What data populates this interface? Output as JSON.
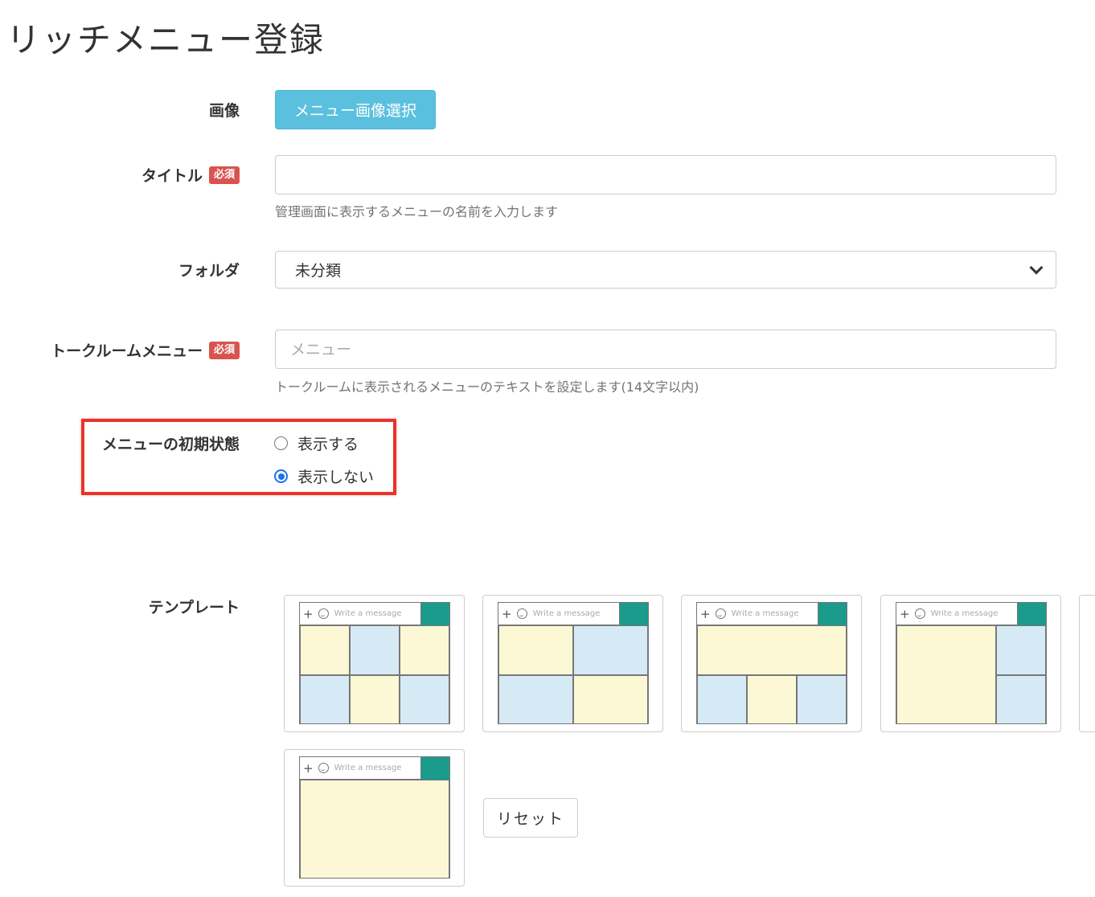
{
  "page_title": "リッチメニュー登録",
  "required_badge": "必須",
  "image": {
    "label": "画像",
    "button_label": "メニュー画像選択"
  },
  "title_field": {
    "label": "タイトル",
    "value": "",
    "help": "管理画面に表示するメニューの名前を入力します"
  },
  "folder": {
    "label": "フォルダ",
    "selected": "未分類"
  },
  "talkroom_menu": {
    "label": "トークルームメニュー",
    "placeholder": "メニュー",
    "help": "トークルームに表示されるメニューのテキストを設定します(14文字以内)"
  },
  "initial_state": {
    "label": "メニューの初期状態",
    "options": [
      {
        "label": "表示する",
        "checked": false
      },
      {
        "label": "表示しない",
        "checked": true
      }
    ]
  },
  "template": {
    "label": "テンプレート",
    "chat_placeholder": "Write a message",
    "reset_label": "リセット"
  },
  "colors": {
    "accent_button": "#5bc0de",
    "required_badge": "#d9534f",
    "highlight_border": "#e8342b",
    "template_teal": "#1a9b8c",
    "cell_yellow": "#fcf8d6",
    "cell_blue": "#d6eaf6"
  }
}
